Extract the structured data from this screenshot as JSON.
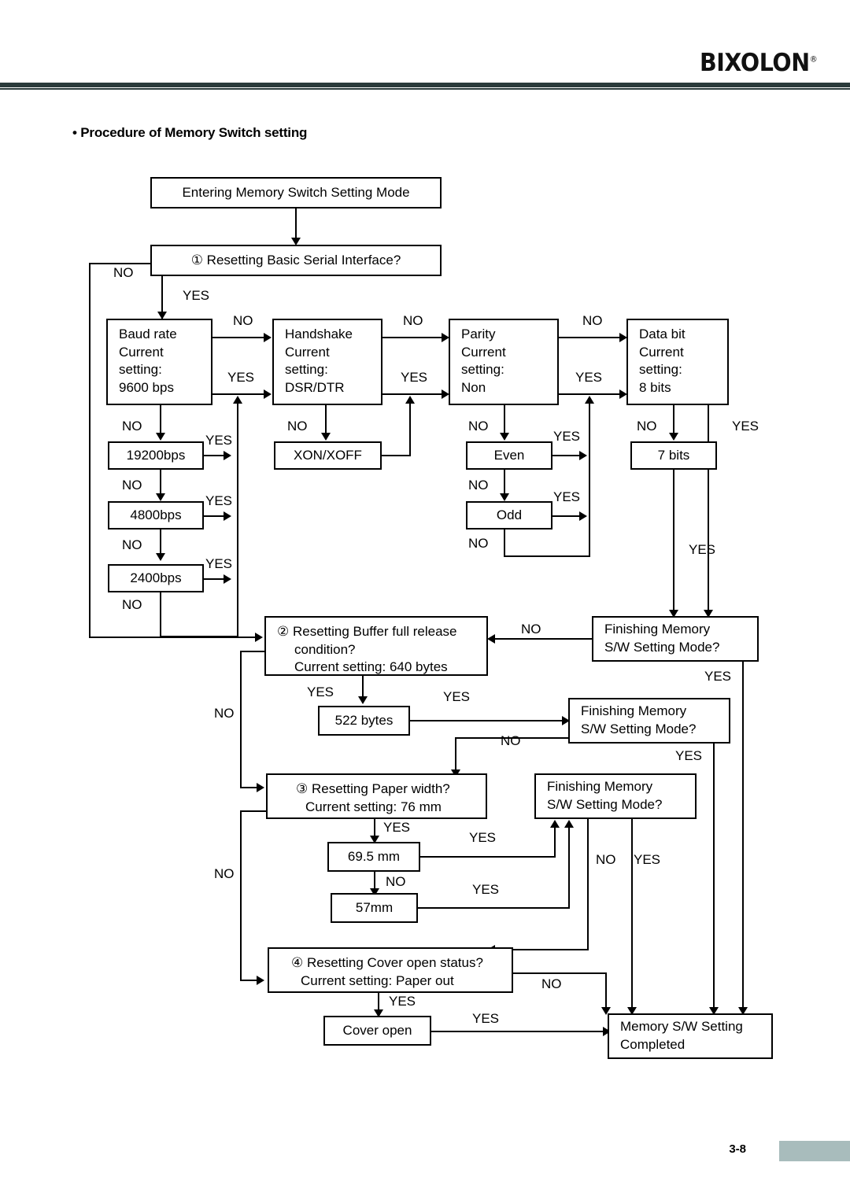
{
  "header": {
    "brand": "BIXOLON",
    "brand_mark": "®",
    "section_title": "• Procedure of Memory Switch setting"
  },
  "footer": {
    "page_number": "3-8"
  },
  "flowchart": {
    "type": "flowchart",
    "nodes": {
      "entering": "Entering Memory Switch Setting Mode",
      "q1": "① Resetting Basic Serial Interface?",
      "baud_l1": "Baud rate",
      "baud_l2": "Current",
      "baud_l3": "setting:",
      "baud_l4": "9600 bps",
      "baud_19200": "19200bps",
      "baud_4800": "4800bps",
      "baud_2400": "2400bps",
      "hand_l1": "Handshake",
      "hand_l2": "Current",
      "hand_l3": "setting:",
      "hand_l4": "DSR/DTR",
      "hand_xon": "XON/XOFF",
      "parity_l1": "Parity",
      "parity_l2": "Current",
      "parity_l3": "setting:",
      "parity_l4": "Non",
      "parity_even": "Even",
      "parity_odd": "Odd",
      "data_l1": "Data bit",
      "data_l2": "Current",
      "data_l3": "setting:",
      "data_l4": "8 bits",
      "data_7bits": "7 bits",
      "q2_l1": "② Resetting Buffer full release",
      "q2_l2": "condition?",
      "q2_l3": "Current setting: 640 bytes",
      "q2_522": "522 bytes",
      "q3_l1": "③ Resetting Paper width?",
      "q3_l2": "Current setting: 76 mm",
      "q3_695": "69.5 mm",
      "q3_57": "57mm",
      "q4_l1": "④ Resetting Cover open status?",
      "q4_l2": "Current setting: Paper out",
      "q4_cover_open": "Cover open",
      "finish1_l1": "Finishing Memory",
      "finish1_l2": "S/W Setting Mode?",
      "finish2_l1": "Finishing Memory",
      "finish2_l2": "S/W Setting Mode?",
      "finish3_l1": "Finishing Memory",
      "finish3_l2": "S/W Setting Mode?",
      "completed_l1": "Memory S/W Setting",
      "completed_l2": "Completed"
    },
    "edge_labels": {
      "q1_no": "NO",
      "q1_yes": "YES",
      "baud_no": "NO",
      "baud_yes": "YES",
      "baud_no2": "NO",
      "baud_19200_yes": "YES",
      "baud_no3": "NO",
      "baud_4800_yes": "YES",
      "baud_no4": "NO",
      "baud_2400_yes": "YES",
      "baud_no5": "NO",
      "hand_no": "NO",
      "hand_yes": "YES",
      "hand_no2": "NO",
      "parity_no": "NO",
      "parity_yes": "YES",
      "parity_no2": "NO",
      "even_yes": "YES",
      "parity_no3": "NO",
      "odd_yes": "YES",
      "parity_no4": "NO",
      "data_no": "NO",
      "data_yes": "YES",
      "data_no2": "NO",
      "bits7_yes": "YES",
      "finish1_no": "NO",
      "finish1_yes": "YES",
      "q2_yes": "YES",
      "q2_no": "NO",
      "b522_yes": "YES",
      "finish2_no": "NO",
      "finish2_yes": "YES",
      "q3_yes": "YES",
      "q3_no": "NO",
      "mm695_yes": "YES",
      "mm695_no": "NO",
      "mm57_yes": "YES",
      "finish3_no": "NO",
      "finish3_yes": "YES",
      "q4_yes": "YES",
      "q4_no": "NO",
      "cover_yes": "YES"
    }
  }
}
